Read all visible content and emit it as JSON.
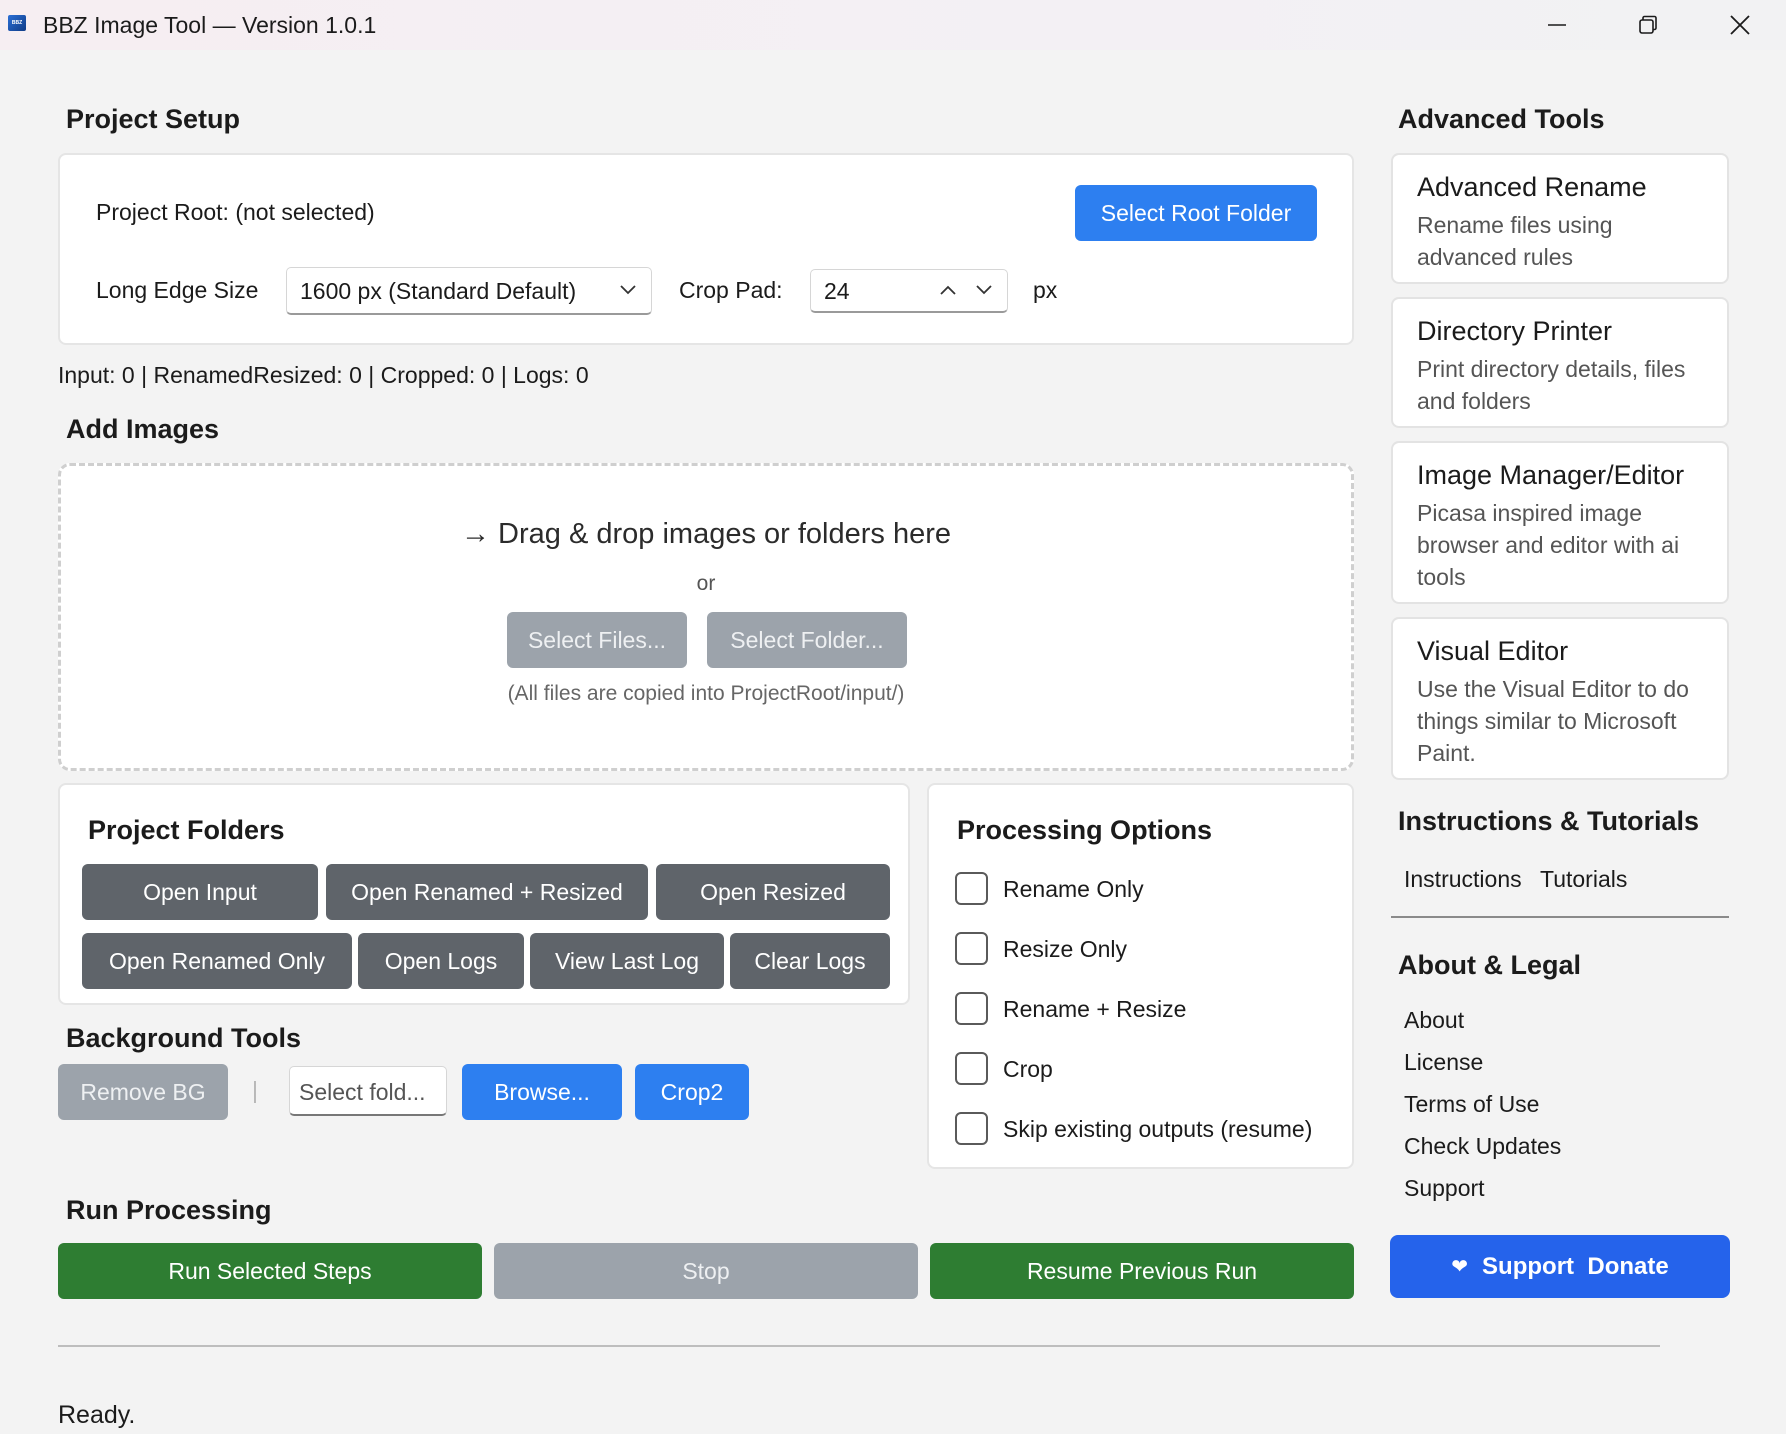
{
  "window": {
    "title": "BBZ Image Tool — Version 1.0.1",
    "icon_text": "BBZ"
  },
  "project_setup": {
    "heading": "Project Setup",
    "root_label": "Project Root: (not selected)",
    "select_root_button": "Select Root Folder",
    "long_edge_label": "Long Edge Size",
    "long_edge_value": "1600 px (Standard Default)",
    "crop_pad_label": "Crop Pad:",
    "crop_pad_value": "24",
    "crop_pad_unit": "px"
  },
  "stats": "Input: 0 | RenamedResized: 0 | Cropped: 0 | Logs: 0",
  "add_images": {
    "heading": "Add Images",
    "drop_text": "→ Drag & drop images or folders here",
    "or_text": "or",
    "select_files_button": "Select Files...",
    "select_folder_button": "Select Folder...",
    "note": "(All files are copied into ProjectRoot/input/)"
  },
  "project_folders": {
    "heading": "Project Folders",
    "row1": [
      "Open Input",
      "Open Renamed + Resized",
      "Open Resized"
    ],
    "row2": [
      "Open Renamed Only",
      "Open Logs",
      "View Last Log",
      "Clear Logs"
    ]
  },
  "processing_options": {
    "heading": "Processing Options",
    "options": [
      {
        "label": "Rename Only",
        "checked": false
      },
      {
        "label": "Resize Only",
        "checked": false
      },
      {
        "label": "Rename + Resize",
        "checked": false
      },
      {
        "label": "Crop",
        "checked": false
      },
      {
        "label": "Skip existing outputs (resume)",
        "checked": false
      }
    ]
  },
  "background_tools": {
    "heading": "Background Tools",
    "remove_bg_button": "Remove BG",
    "separator": "|",
    "folder_placeholder": "Select fold...",
    "browse_button": "Browse...",
    "crop2_button": "Crop2"
  },
  "run_processing": {
    "heading": "Run Processing",
    "run_button": "Run Selected Steps",
    "stop_button": "Stop",
    "resume_button": "Resume Previous Run"
  },
  "status": "Ready.",
  "advanced_tools": {
    "heading": "Advanced Tools",
    "tools": [
      {
        "title": "Advanced Rename",
        "desc": "Rename files using advanced rules"
      },
      {
        "title": "Directory Printer",
        "desc": "Print directory details, files and folders"
      },
      {
        "title": "Image Manager/Editor",
        "desc": "Picasa inspired image browser and editor with ai tools"
      },
      {
        "title": "Visual Editor",
        "desc": "Use the Visual Editor to do things similar to Microsoft Paint."
      }
    ]
  },
  "instructions": {
    "heading": "Instructions & Tutorials",
    "links": [
      "Instructions",
      "Tutorials"
    ]
  },
  "about": {
    "heading": "About & Legal",
    "links": [
      "About",
      "License",
      "Terms of Use",
      "Check Updates",
      "Support"
    ]
  },
  "donate": {
    "heart": "❤",
    "label": "Support  Donate"
  },
  "colors": {
    "accent_blue": "#2d7ff0",
    "donate_blue": "#2563eb",
    "run_green": "#2e7d32",
    "dark_button": "#5f646a",
    "disabled_button": "#9ca3ab"
  }
}
